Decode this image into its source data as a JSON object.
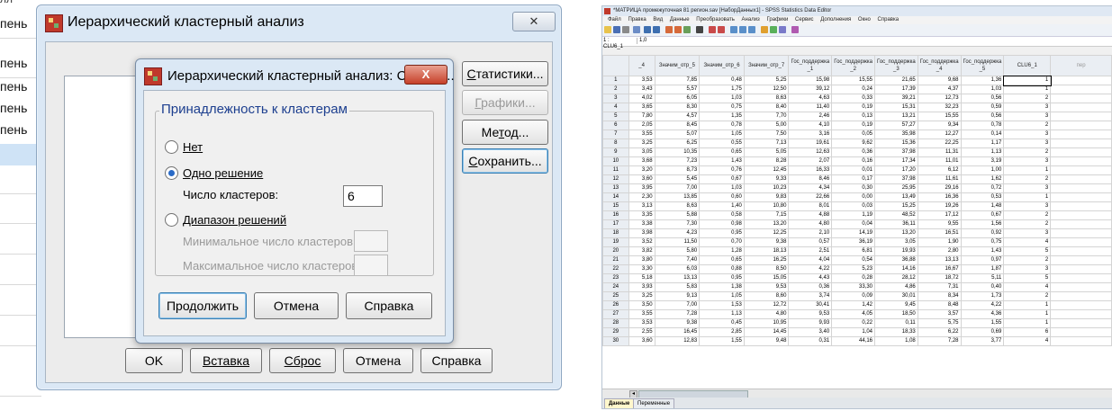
{
  "background": {
    "rows": [
      "пень",
      "пень",
      "пень",
      "пень",
      "пень"
    ],
    "top_fragment": "лл"
  },
  "outer_dialog": {
    "title": "Иерархический кластерный анализ",
    "close_glyph": "✕",
    "side_buttons": [
      {
        "label": "Статистики...",
        "ul": "С",
        "disabled": false
      },
      {
        "label": "Графики...",
        "ul": "Г",
        "disabled": true
      },
      {
        "label": "Метод...",
        "ul": "т",
        "disabled": false
      },
      {
        "label": "Сохранить...",
        "ul": "С",
        "disabled": false
      }
    ],
    "bottom_buttons": [
      "OK",
      "Вставка",
      "Сброс",
      "Отмена",
      "Справка"
    ]
  },
  "inner_dialog": {
    "title": "Иерархический кластерный анализ: Сохран...",
    "close_glyph": "X",
    "group_title": "Принадлежность к кластерам",
    "radio_none": "Нет",
    "radio_single": "Одно решение",
    "num_clusters_label": "Число кластеров:",
    "num_clusters_value": "6",
    "radio_range": "Диапазон решений",
    "min_clusters_label": "Минимальное число кластеров:",
    "max_clusters_label": "Максимальное число кластеров:",
    "selected": "single",
    "btn_continue": "Продолжить",
    "btn_cancel": "Отмена",
    "btn_help": "Справка"
  },
  "data_editor": {
    "title": "*МАТРИЦА промежуточная 81 регион.sav [НаборДанных1] - SPSS Statistics Data Editor",
    "menu": [
      "Файл",
      "Правка",
      "Вид",
      "Данные",
      "Преобразовать",
      "Анализ",
      "Графики",
      "Сервис",
      "Дополнения",
      "Окно",
      "Справка"
    ],
    "cell_ref": "1 : CLU6_1",
    "cell_value": "1,0",
    "columns": [
      "_4",
      "Значим_отр_5",
      "Значим_отр_6",
      "Значим_отр_7",
      "Гос_поддержка _1",
      "Гос_поддержка _2",
      "Гос_поддержка _3",
      "Гос_поддержка _4",
      "Гос_поддержка _5",
      "CLU6_1",
      "пер"
    ],
    "rows": [
      [
        "1",
        "3,53",
        "7,85",
        "0,48",
        "5,25",
        "15,98",
        "15,55",
        "21,65",
        "9,68",
        "1,36",
        "1"
      ],
      [
        "2",
        "3,43",
        "5,57",
        "1,75",
        "12,50",
        "39,12",
        "0,24",
        "17,39",
        "4,37",
        "1,03",
        "1"
      ],
      [
        "3",
        "4,02",
        "6,05",
        "1,03",
        "8,63",
        "4,63",
        "0,33",
        "39,21",
        "12,73",
        "0,56",
        "2"
      ],
      [
        "4",
        "3,65",
        "8,30",
        "0,75",
        "8,40",
        "11,40",
        "0,19",
        "15,31",
        "32,23",
        "0,59",
        "3"
      ],
      [
        "5",
        "7,80",
        "4,57",
        "1,35",
        "7,70",
        "2,46",
        "0,13",
        "13,21",
        "15,55",
        "0,56",
        "3"
      ],
      [
        "6",
        "2,05",
        "8,45",
        "0,78",
        "5,00",
        "4,10",
        "0,19",
        "57,27",
        "9,34",
        "0,78",
        "2"
      ],
      [
        "7",
        "3,55",
        "5,07",
        "1,05",
        "7,50",
        "3,16",
        "0,05",
        "35,98",
        "12,27",
        "0,14",
        "3"
      ],
      [
        "8",
        "3,25",
        "6,25",
        "0,55",
        "7,13",
        "19,61",
        "9,62",
        "15,36",
        "22,25",
        "1,17",
        "3"
      ],
      [
        "9",
        "3,05",
        "10,35",
        "0,65",
        "5,05",
        "12,63",
        "0,36",
        "37,98",
        "11,31",
        "1,13",
        "2"
      ],
      [
        "10",
        "3,68",
        "7,23",
        "1,43",
        "8,28",
        "2,07",
        "0,16",
        "17,34",
        "11,01",
        "3,19",
        "3"
      ],
      [
        "11",
        "3,20",
        "8,73",
        "0,76",
        "12,45",
        "16,33",
        "0,01",
        "17,20",
        "6,12",
        "1,00",
        "1"
      ],
      [
        "12",
        "3,60",
        "5,45",
        "0,67",
        "9,33",
        "8,46",
        "0,17",
        "37,98",
        "11,61",
        "1,62",
        "2"
      ],
      [
        "13",
        "3,95",
        "7,00",
        "1,03",
        "10,23",
        "4,34",
        "0,30",
        "25,95",
        "29,16",
        "0,72",
        "3"
      ],
      [
        "14",
        "2,30",
        "13,85",
        "0,60",
        "9,83",
        "22,66",
        "0,00",
        "13,49",
        "16,36",
        "0,53",
        "1"
      ],
      [
        "15",
        "3,13",
        "8,63",
        "1,40",
        "10,80",
        "8,01",
        "0,03",
        "15,25",
        "19,26",
        "1,48",
        "3"
      ],
      [
        "16",
        "3,35",
        "5,88",
        "0,58",
        "7,15",
        "4,88",
        "1,19",
        "48,52",
        "17,12",
        "0,67",
        "2"
      ],
      [
        "17",
        "3,38",
        "7,30",
        "0,98",
        "13,20",
        "4,80",
        "0,04",
        "36,11",
        "9,55",
        "1,56",
        "2"
      ],
      [
        "18",
        "3,98",
        "4,23",
        "0,95",
        "12,25",
        "2,10",
        "14,19",
        "13,20",
        "16,51",
        "0,92",
        "3"
      ],
      [
        "19",
        "3,52",
        "11,50",
        "0,70",
        "9,38",
        "0,57",
        "36,19",
        "3,05",
        "1,90",
        "0,75",
        "4"
      ],
      [
        "20",
        "3,82",
        "5,80",
        "1,28",
        "18,13",
        "2,51",
        "6,81",
        "19,93",
        "2,80",
        "1,43",
        "5"
      ],
      [
        "21",
        "3,80",
        "7,40",
        "0,65",
        "16,25",
        "4,04",
        "0,54",
        "36,88",
        "13,13",
        "0,97",
        "2"
      ],
      [
        "22",
        "3,30",
        "6,03",
        "0,88",
        "8,50",
        "4,22",
        "5,23",
        "14,16",
        "16,67",
        "1,87",
        "3"
      ],
      [
        "23",
        "5,18",
        "13,13",
        "0,95",
        "15,05",
        "4,43",
        "0,28",
        "28,12",
        "18,72",
        "5,11",
        "5"
      ],
      [
        "24",
        "3,93",
        "5,83",
        "1,38",
        "9,53",
        "0,36",
        "33,30",
        "4,86",
        "7,31",
        "0,40",
        "4"
      ],
      [
        "25",
        "3,25",
        "9,13",
        "1,05",
        "8,60",
        "3,74",
        "0,09",
        "30,01",
        "8,34",
        "1,73",
        "2"
      ],
      [
        "26",
        "3,50",
        "7,00",
        "1,53",
        "12,72",
        "30,41",
        "1,42",
        "9,45",
        "8,48",
        "4,22",
        "1"
      ],
      [
        "27",
        "3,55",
        "7,28",
        "1,13",
        "4,80",
        "9,53",
        "4,05",
        "18,50",
        "3,57",
        "4,36",
        "1"
      ],
      [
        "28",
        "3,53",
        "9,38",
        "0,45",
        "10,95",
        "9,93",
        "0,22",
        "0,11",
        "5,75",
        "1,55",
        "1"
      ],
      [
        "29",
        "2,55",
        "16,45",
        "2,85",
        "14,45",
        "3,40",
        "1,04",
        "18,33",
        "6,22",
        "0,69",
        "6"
      ],
      [
        "30",
        "3,60",
        "12,83",
        "1,55",
        "9,48",
        "0,31",
        "44,16",
        "1,08",
        "7,28",
        "3,77",
        "4"
      ]
    ],
    "tabs": [
      "Данные",
      "Переменные"
    ]
  }
}
